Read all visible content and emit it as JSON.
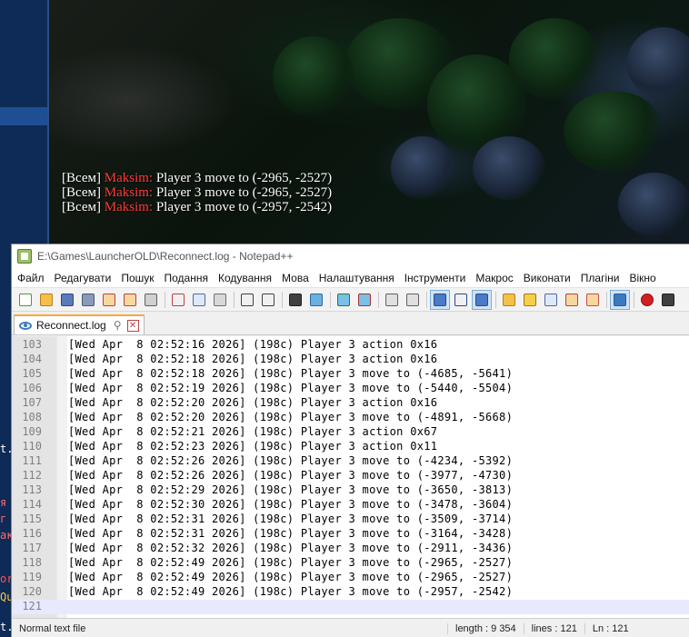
{
  "game": {
    "chat": [
      {
        "channel": "[Всем]",
        "sender": "Maksim:",
        "message": "Player 3 move to (-2965, -2527)"
      },
      {
        "channel": "[Всем]",
        "sender": "Maksim:",
        "message": "Player 3 move to (-2965, -2527)"
      },
      {
        "channel": "[Всем]",
        "sender": "Maksim:",
        "message": "Player 3 move to (-2957, -2542)"
      }
    ],
    "left_fragments": [
      {
        "text": "t.",
        "color": "#ffffff"
      },
      {
        "text": "я",
        "color": "#ff6a6a"
      },
      {
        "text": " г",
        "color": "#ff6a6a"
      },
      {
        "text": "ак",
        "color": "#ff6a6a"
      },
      {
        "text": "or",
        "color": "#ff5555"
      },
      {
        "text": "Qu",
        "color": "#ffcc33"
      },
      {
        "text": "t.",
        "color": "#ffffff"
      }
    ]
  },
  "window": {
    "title": "E:\\Games\\LauncherOLD\\Reconnect.log - Notepad++",
    "menu": [
      "Файл",
      "Редагувати",
      "Пошук",
      "Подання",
      "Кодування",
      "Мова",
      "Налаштування",
      "Інструменти",
      "Макрос",
      "Виконати",
      "Плагіни",
      "Вікно"
    ],
    "toolbar_icons": [
      {
        "name": "new-file-icon",
        "color": "#ffffff",
        "border": "#4a9a3a"
      },
      {
        "name": "open-file-icon",
        "color": "#f4c04a",
        "border": "#b08020"
      },
      {
        "name": "save-icon",
        "color": "#5a7ab8",
        "border": "#2a4a88"
      },
      {
        "name": "save-all-icon",
        "color": "#8a9ab8",
        "border": "#4a5a78"
      },
      {
        "name": "close-file-icon",
        "color": "#f6d7a0",
        "border": "#c04040"
      },
      {
        "name": "close-all-icon",
        "color": "#f6d7a0",
        "border": "#c04040"
      },
      {
        "name": "print-icon",
        "color": "#d0d0d0",
        "border": "#606060"
      },
      {
        "sep": true
      },
      {
        "name": "cut-icon",
        "color": "#f0f0f0",
        "border": "#c04040"
      },
      {
        "name": "copy-icon",
        "color": "#dfe8f7",
        "border": "#4a6aa8"
      },
      {
        "name": "paste-icon",
        "color": "#d8d8d8",
        "border": "#707070"
      },
      {
        "sep": true
      },
      {
        "name": "undo-icon",
        "color": "#f0f0f0",
        "border": "#404040"
      },
      {
        "name": "redo-icon",
        "color": "#f0f0f0",
        "border": "#404040"
      },
      {
        "sep": true
      },
      {
        "name": "find-icon",
        "color": "#404040",
        "border": "#202020"
      },
      {
        "name": "replace-icon",
        "color": "#6ab0e0",
        "border": "#2a6a9a"
      },
      {
        "sep": true
      },
      {
        "name": "zoom-in-icon",
        "color": "#7ac0e8",
        "border": "#2a7a2a"
      },
      {
        "name": "zoom-out-icon",
        "color": "#7ac0e8",
        "border": "#b03030"
      },
      {
        "sep": true
      },
      {
        "name": "sync-vertical-icon",
        "color": "#e0e0e0",
        "border": "#606060"
      },
      {
        "name": "sync-horizontal-icon",
        "color": "#e0e0e0",
        "border": "#606060"
      },
      {
        "sep": true
      },
      {
        "name": "word-wrap-icon",
        "color": "#4a7ac8",
        "border": "#2a4a88",
        "active": true
      },
      {
        "name": "show-all-chars-icon",
        "color": "#f0f0f0",
        "border": "#2a4a88"
      },
      {
        "name": "indent-guide-icon",
        "color": "#4a7ac8",
        "border": "#2a4a88",
        "active": true
      },
      {
        "sep": true
      },
      {
        "name": "udl-icon",
        "color": "#f4c04a",
        "border": "#b08020"
      },
      {
        "name": "doc-map-icon",
        "color": "#f4d04a",
        "border": "#a07a10"
      },
      {
        "name": "function-list-icon",
        "color": "#dfe8f7",
        "border": "#4a6aa8"
      },
      {
        "name": "folder-workspace-icon",
        "color": "#f6d7a0",
        "border": "#c04040"
      },
      {
        "name": "doc-list-icon",
        "color": "#f6d7a0",
        "border": "#c05050"
      },
      {
        "sep": true
      },
      {
        "name": "monitoring-icon",
        "color": "#3a7ac0",
        "border": "#2a5a98",
        "active": true
      },
      {
        "sep": true
      },
      {
        "name": "record-macro-icon",
        "color": "#d02020",
        "border": "#901010"
      },
      {
        "name": "stop-record-icon",
        "color": "#404040",
        "border": "#202020"
      }
    ],
    "tab": {
      "label": "Reconnect.log",
      "pin": "⚲",
      "close": "✕"
    },
    "editor": {
      "lines": [
        {
          "n": "103",
          "text": "[Wed Apr  8 02:52:16 2026] (198c) Player 3 action 0x16"
        },
        {
          "n": "104",
          "text": "[Wed Apr  8 02:52:18 2026] (198c) Player 3 action 0x16"
        },
        {
          "n": "105",
          "text": "[Wed Apr  8 02:52:18 2026] (198c) Player 3 move to (-4685, -5641)"
        },
        {
          "n": "106",
          "text": "[Wed Apr  8 02:52:19 2026] (198c) Player 3 move to (-5440, -5504)"
        },
        {
          "n": "107",
          "text": "[Wed Apr  8 02:52:20 2026] (198c) Player 3 action 0x16"
        },
        {
          "n": "108",
          "text": "[Wed Apr  8 02:52:20 2026] (198c) Player 3 move to (-4891, -5668)"
        },
        {
          "n": "109",
          "text": "[Wed Apr  8 02:52:21 2026] (198c) Player 3 action 0x67"
        },
        {
          "n": "110",
          "text": "[Wed Apr  8 02:52:23 2026] (198c) Player 3 action 0x11"
        },
        {
          "n": "111",
          "text": "[Wed Apr  8 02:52:26 2026] (198c) Player 3 move to (-4234, -5392)"
        },
        {
          "n": "112",
          "text": "[Wed Apr  8 02:52:26 2026] (198c) Player 3 move to (-3977, -4730)"
        },
        {
          "n": "113",
          "text": "[Wed Apr  8 02:52:29 2026] (198c) Player 3 move to (-3650, -3813)"
        },
        {
          "n": "114",
          "text": "[Wed Apr  8 02:52:30 2026] (198c) Player 3 move to (-3478, -3604)"
        },
        {
          "n": "115",
          "text": "[Wed Apr  8 02:52:31 2026] (198c) Player 3 move to (-3509, -3714)"
        },
        {
          "n": "116",
          "text": "[Wed Apr  8 02:52:31 2026] (198c) Player 3 move to (-3164, -3428)"
        },
        {
          "n": "117",
          "text": "[Wed Apr  8 02:52:32 2026] (198c) Player 3 move to (-2911, -3436)"
        },
        {
          "n": "118",
          "text": "[Wed Apr  8 02:52:49 2026] (198c) Player 3 move to (-2965, -2527)"
        },
        {
          "n": "119",
          "text": "[Wed Apr  8 02:52:49 2026] (198c) Player 3 move to (-2965, -2527)"
        },
        {
          "n": "120",
          "text": "[Wed Apr  8 02:52:49 2026] (198c) Player 3 move to (-2957, -2542)"
        },
        {
          "n": "121",
          "text": ""
        }
      ],
      "current_line": "121"
    },
    "status": {
      "type": "Normal text file",
      "length": "length : 9 354",
      "lines": "lines : 121",
      "position": "Ln : 121"
    }
  }
}
